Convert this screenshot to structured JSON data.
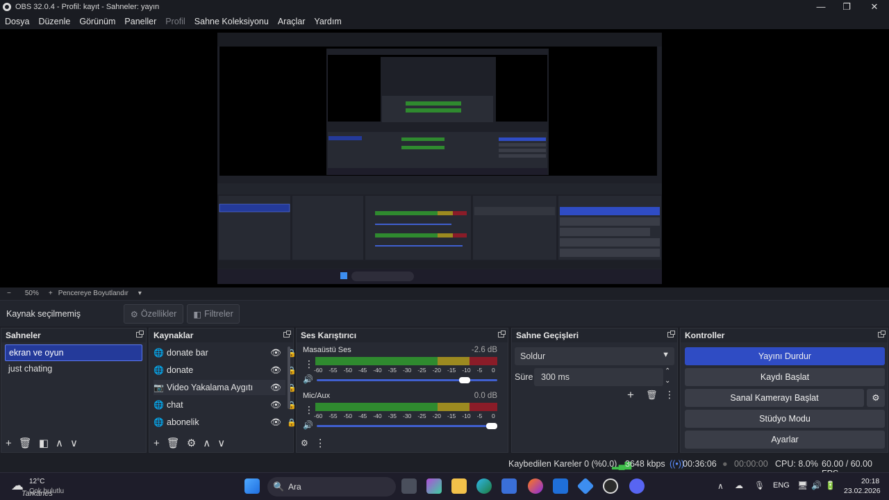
{
  "window": {
    "title": "OBS 32.0.4 - Profil: kayıt - Sahneler: yayın",
    "minimize": "—",
    "maximize": "❐",
    "close": "✕"
  },
  "menu": [
    "Dosya",
    "Düzenle",
    "Görünüm",
    "Paneller",
    "Profil",
    "Sahne Koleksiyonu",
    "Araçlar",
    "Yardım"
  ],
  "preview_toolbar": {
    "minus": "−",
    "zoom": "50%",
    "plus": "+",
    "mode": "Pencereye Boyutlandır",
    "caret": "▾"
  },
  "context": {
    "label": "Kaynak seçilmemiş",
    "properties": "Özellikler",
    "filters": "Filtreler"
  },
  "scenes": {
    "title": "Sahneler",
    "items": [
      "ekran ve oyun",
      "just chating"
    ],
    "selected_index": 0
  },
  "sources": {
    "title": "Kaynaklar",
    "items": [
      {
        "label": "donate bar",
        "icon": "globe-icon"
      },
      {
        "label": "donate",
        "icon": "globe-icon"
      },
      {
        "label": "Video Yakalama Aygıtı",
        "icon": "camera-icon"
      },
      {
        "label": "chat",
        "icon": "globe-icon"
      },
      {
        "label": "abonelik",
        "icon": "globe-icon"
      }
    ]
  },
  "mixer": {
    "title": "Ses Karıştırıcı",
    "channels": [
      {
        "name": "Masaüstü Ses",
        "db": "-2.6 dB",
        "volume": 0.85
      },
      {
        "name": "Mic/Aux",
        "db": "0.0 dB",
        "volume": 1.0
      }
    ],
    "ticks": [
      "-60",
      "-55",
      "-50",
      "-45",
      "-40",
      "-35",
      "-30",
      "-25",
      "-20",
      "-15",
      "-10",
      "-5",
      "0"
    ]
  },
  "transitions": {
    "title": "Sahne Geçişleri",
    "selected": "Soldur",
    "duration_label": "Süre",
    "duration_value": "300 ms"
  },
  "controls": {
    "title": "Kontroller",
    "stream": "Yayını Durdur",
    "record": "Kaydı Başlat",
    "virtualcam": "Sanal Kamerayı Başlat",
    "studio": "Stüdyo Modu",
    "settings": "Ayarlar"
  },
  "status": {
    "dropped": "Kaybedilen Kareler 0 (%0.0)",
    "bitrate": "3648 kbps",
    "stream_time": "00:36:06",
    "rec_time": "00:00:00",
    "cpu": "CPU: 8.0%",
    "fps": "60.00 / 60.00 FPS"
  },
  "taskbar": {
    "weather_temp": "12°C",
    "weather_desc": "Çok bulutlu",
    "overlay": "Tarkanes",
    "search": "Ara",
    "lang": "ENG",
    "time": "20:18",
    "date": "23.02.2026"
  },
  "colors": {
    "accent": "#2f4cc4",
    "selection": "#243a9a",
    "meter_green": "#2f8a2f",
    "meter_yellow": "#9c8a20",
    "meter_red": "#8a1c28"
  }
}
